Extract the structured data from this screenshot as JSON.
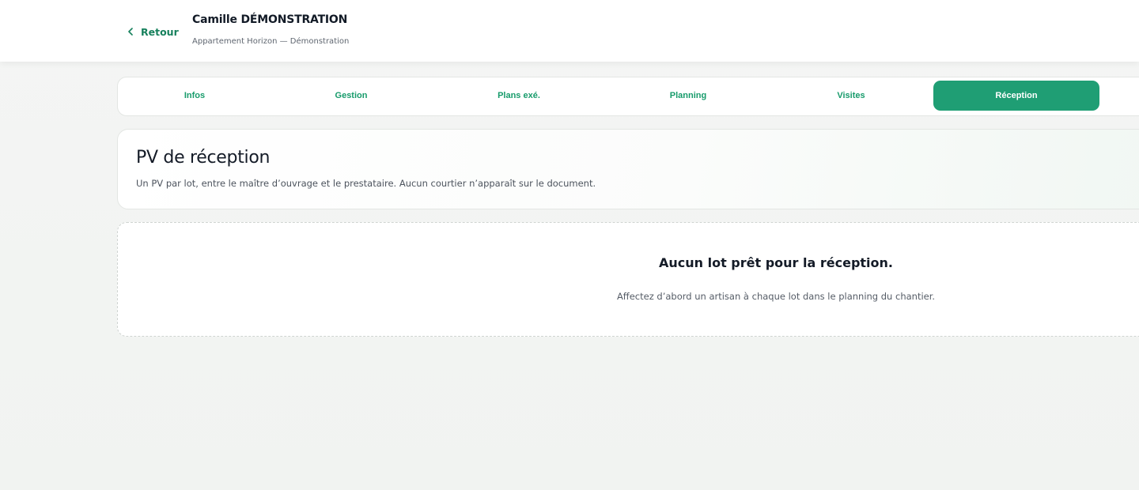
{
  "header": {
    "back_label": "Retour",
    "title": "Camille DÉMONSTRATION",
    "subtitle": "Appartement Horizon — Démonstration"
  },
  "tabs": [
    {
      "label": "Infos",
      "active": false
    },
    {
      "label": "Gestion",
      "active": false
    },
    {
      "label": "Plans exé.",
      "active": false
    },
    {
      "label": "Planning",
      "active": false
    },
    {
      "label": "Visites",
      "active": false
    },
    {
      "label": "Réception",
      "active": true
    }
  ],
  "section": {
    "title": "PV de réception",
    "description": "Un PV par lot, entre le maître d’ouvrage et le prestataire. Aucun courtier n’apparaît sur le document."
  },
  "empty_state": {
    "title": "Aucun lot prêt pour la réception.",
    "message": "Affectez d’abord un artisan à chaque lot dans le planning du chantier."
  },
  "colors": {
    "accent": "#1f9e74",
    "accent_text": "#179b6b",
    "background": "#f2f4f2"
  },
  "icons": {
    "back": "chevron-left-icon"
  }
}
